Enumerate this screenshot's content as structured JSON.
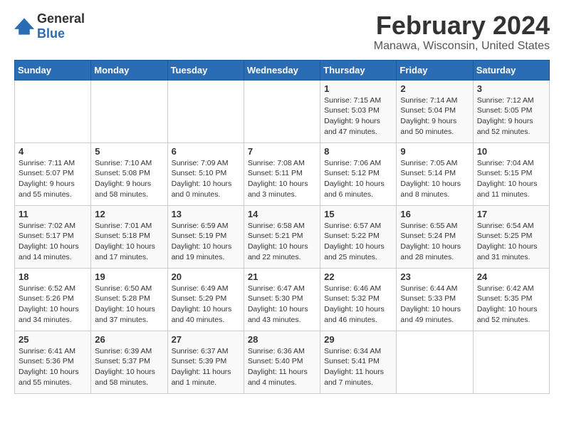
{
  "logo": {
    "text_general": "General",
    "text_blue": "Blue"
  },
  "title": {
    "month_year": "February 2024",
    "location": "Manawa, Wisconsin, United States"
  },
  "weekdays": [
    "Sunday",
    "Monday",
    "Tuesday",
    "Wednesday",
    "Thursday",
    "Friday",
    "Saturday"
  ],
  "weeks": [
    [
      {
        "day": "",
        "info": ""
      },
      {
        "day": "",
        "info": ""
      },
      {
        "day": "",
        "info": ""
      },
      {
        "day": "",
        "info": ""
      },
      {
        "day": "1",
        "info": "Sunrise: 7:15 AM\nSunset: 5:03 PM\nDaylight: 9 hours\nand 47 minutes."
      },
      {
        "day": "2",
        "info": "Sunrise: 7:14 AM\nSunset: 5:04 PM\nDaylight: 9 hours\nand 50 minutes."
      },
      {
        "day": "3",
        "info": "Sunrise: 7:12 AM\nSunset: 5:05 PM\nDaylight: 9 hours\nand 52 minutes."
      }
    ],
    [
      {
        "day": "4",
        "info": "Sunrise: 7:11 AM\nSunset: 5:07 PM\nDaylight: 9 hours\nand 55 minutes."
      },
      {
        "day": "5",
        "info": "Sunrise: 7:10 AM\nSunset: 5:08 PM\nDaylight: 9 hours\nand 58 minutes."
      },
      {
        "day": "6",
        "info": "Sunrise: 7:09 AM\nSunset: 5:10 PM\nDaylight: 10 hours\nand 0 minutes."
      },
      {
        "day": "7",
        "info": "Sunrise: 7:08 AM\nSunset: 5:11 PM\nDaylight: 10 hours\nand 3 minutes."
      },
      {
        "day": "8",
        "info": "Sunrise: 7:06 AM\nSunset: 5:12 PM\nDaylight: 10 hours\nand 6 minutes."
      },
      {
        "day": "9",
        "info": "Sunrise: 7:05 AM\nSunset: 5:14 PM\nDaylight: 10 hours\nand 8 minutes."
      },
      {
        "day": "10",
        "info": "Sunrise: 7:04 AM\nSunset: 5:15 PM\nDaylight: 10 hours\nand 11 minutes."
      }
    ],
    [
      {
        "day": "11",
        "info": "Sunrise: 7:02 AM\nSunset: 5:17 PM\nDaylight: 10 hours\nand 14 minutes."
      },
      {
        "day": "12",
        "info": "Sunrise: 7:01 AM\nSunset: 5:18 PM\nDaylight: 10 hours\nand 17 minutes."
      },
      {
        "day": "13",
        "info": "Sunrise: 6:59 AM\nSunset: 5:19 PM\nDaylight: 10 hours\nand 19 minutes."
      },
      {
        "day": "14",
        "info": "Sunrise: 6:58 AM\nSunset: 5:21 PM\nDaylight: 10 hours\nand 22 minutes."
      },
      {
        "day": "15",
        "info": "Sunrise: 6:57 AM\nSunset: 5:22 PM\nDaylight: 10 hours\nand 25 minutes."
      },
      {
        "day": "16",
        "info": "Sunrise: 6:55 AM\nSunset: 5:24 PM\nDaylight: 10 hours\nand 28 minutes."
      },
      {
        "day": "17",
        "info": "Sunrise: 6:54 AM\nSunset: 5:25 PM\nDaylight: 10 hours\nand 31 minutes."
      }
    ],
    [
      {
        "day": "18",
        "info": "Sunrise: 6:52 AM\nSunset: 5:26 PM\nDaylight: 10 hours\nand 34 minutes."
      },
      {
        "day": "19",
        "info": "Sunrise: 6:50 AM\nSunset: 5:28 PM\nDaylight: 10 hours\nand 37 minutes."
      },
      {
        "day": "20",
        "info": "Sunrise: 6:49 AM\nSunset: 5:29 PM\nDaylight: 10 hours\nand 40 minutes."
      },
      {
        "day": "21",
        "info": "Sunrise: 6:47 AM\nSunset: 5:30 PM\nDaylight: 10 hours\nand 43 minutes."
      },
      {
        "day": "22",
        "info": "Sunrise: 6:46 AM\nSunset: 5:32 PM\nDaylight: 10 hours\nand 46 minutes."
      },
      {
        "day": "23",
        "info": "Sunrise: 6:44 AM\nSunset: 5:33 PM\nDaylight: 10 hours\nand 49 minutes."
      },
      {
        "day": "24",
        "info": "Sunrise: 6:42 AM\nSunset: 5:35 PM\nDaylight: 10 hours\nand 52 minutes."
      }
    ],
    [
      {
        "day": "25",
        "info": "Sunrise: 6:41 AM\nSunset: 5:36 PM\nDaylight: 10 hours\nand 55 minutes."
      },
      {
        "day": "26",
        "info": "Sunrise: 6:39 AM\nSunset: 5:37 PM\nDaylight: 10 hours\nand 58 minutes."
      },
      {
        "day": "27",
        "info": "Sunrise: 6:37 AM\nSunset: 5:39 PM\nDaylight: 11 hours\nand 1 minute."
      },
      {
        "day": "28",
        "info": "Sunrise: 6:36 AM\nSunset: 5:40 PM\nDaylight: 11 hours\nand 4 minutes."
      },
      {
        "day": "29",
        "info": "Sunrise: 6:34 AM\nSunset: 5:41 PM\nDaylight: 11 hours\nand 7 minutes."
      },
      {
        "day": "",
        "info": ""
      },
      {
        "day": "",
        "info": ""
      }
    ]
  ]
}
